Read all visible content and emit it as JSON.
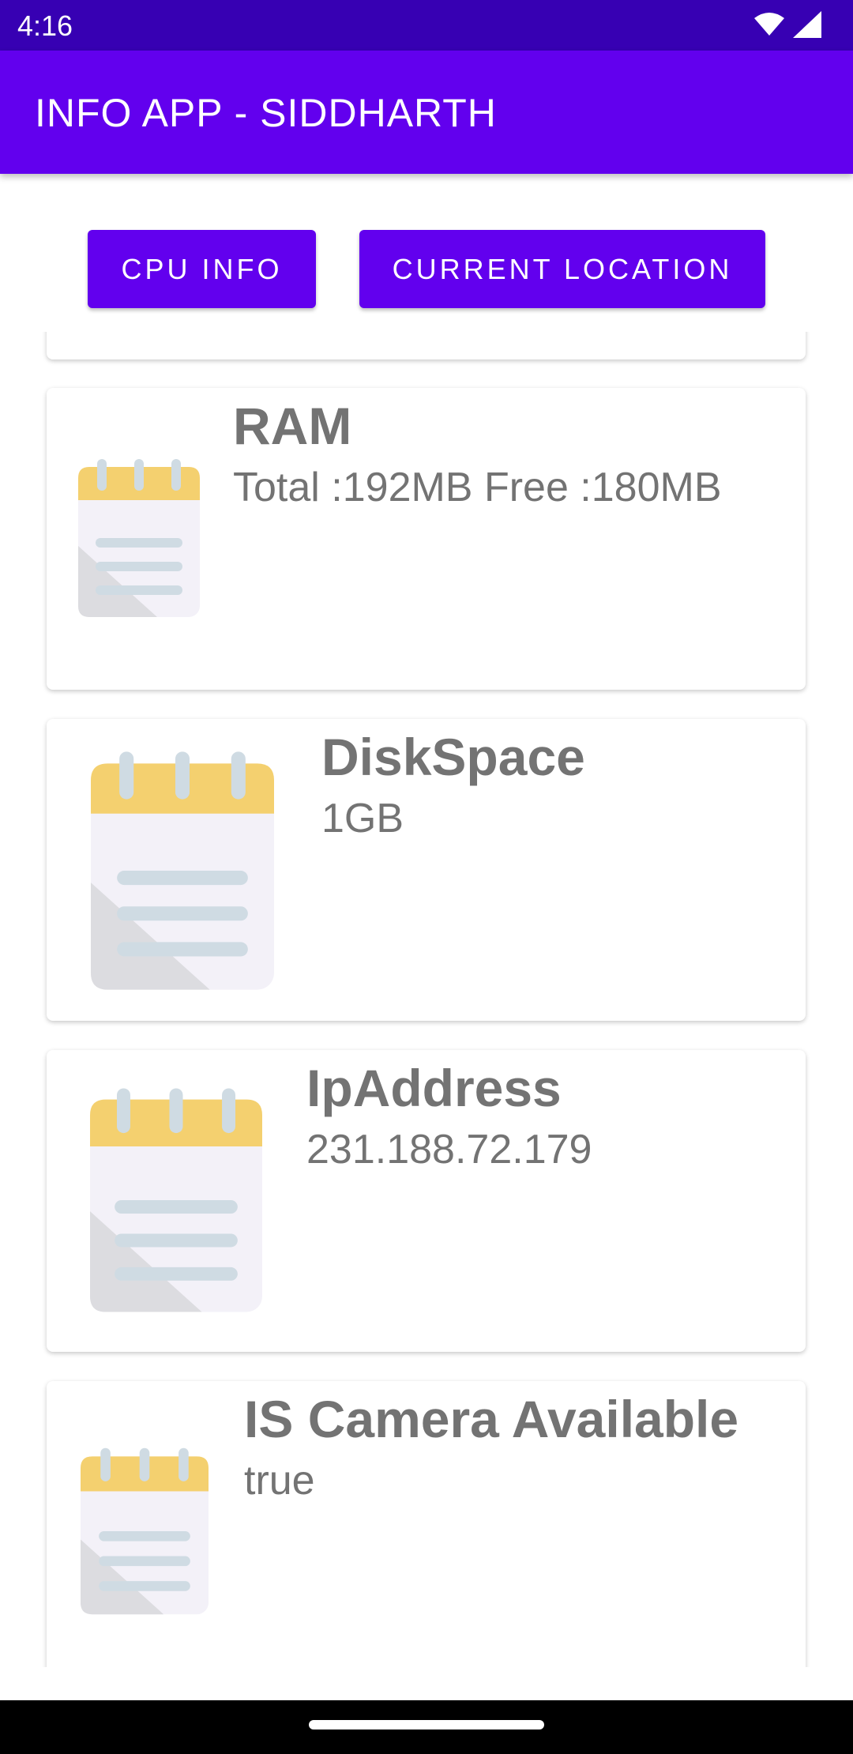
{
  "status": {
    "time": "4:16",
    "wifi_icon": "wifi-icon",
    "signal_icon": "signal-icon"
  },
  "app_bar": {
    "title": "INFO APP - SIDDHARTH"
  },
  "buttons": {
    "cpu_info": "CPU INFO",
    "current_location": "CURRENT LOCATION"
  },
  "colors": {
    "status_bar": "#3700b3",
    "primary": "#6200ee",
    "text_gray": "#737373"
  },
  "cards": [
    {
      "title": "RAM",
      "value": "Total :192MB  Free :180MB",
      "icon": "notepad-icon"
    },
    {
      "title": "DiskSpace",
      "value": "1GB",
      "icon": "notepad-icon"
    },
    {
      "title": "IpAddress",
      "value": "231.188.72.179",
      "icon": "notepad-icon"
    },
    {
      "title": "IS Camera Available",
      "value": "true",
      "icon": "notepad-icon"
    }
  ]
}
